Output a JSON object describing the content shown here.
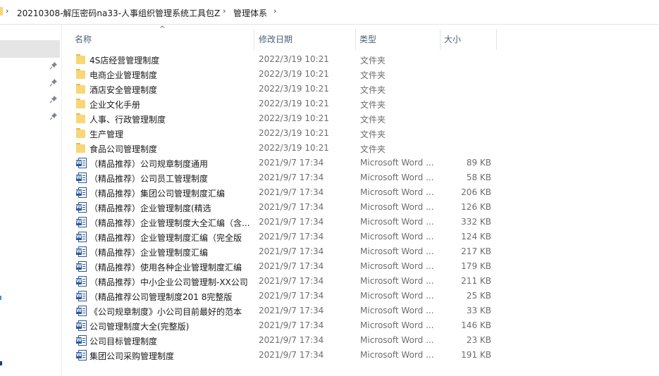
{
  "breadcrumb": {
    "items": [
      "20210308-解压密码na33-人事组织管理系统工具包Z",
      "管理体系"
    ],
    "separator": "›"
  },
  "columns": {
    "name": "名称",
    "modified": "修改日期",
    "type": "类型",
    "size": "大小"
  },
  "colors": {
    "folder": "#f8d775",
    "word": "#2b579a",
    "header_text": "#4c607a",
    "nav_selected": "#e5e5e5"
  },
  "files": [
    {
      "name": "4S店经营管理制度",
      "date": "2022/3/19 10:21",
      "type": "文件夹",
      "size": "",
      "icon": "folder-icon"
    },
    {
      "name": "电商企业管理制度",
      "date": "2022/3/19 10:21",
      "type": "文件夹",
      "size": "",
      "icon": "folder-icon"
    },
    {
      "name": "酒店安全管理制度",
      "date": "2022/3/19 10:21",
      "type": "文件夹",
      "size": "",
      "icon": "folder-icon"
    },
    {
      "name": "企业文化手册",
      "date": "2022/3/19 10:21",
      "type": "文件夹",
      "size": "",
      "icon": "folder-icon"
    },
    {
      "name": "人事、行政管理制度",
      "date": "2022/3/19 10:21",
      "type": "文件夹",
      "size": "",
      "icon": "folder-icon"
    },
    {
      "name": "生产管理",
      "date": "2022/3/19 10:21",
      "type": "文件夹",
      "size": "",
      "icon": "folder-icon"
    },
    {
      "name": "食品公司管理制度",
      "date": "2022/3/19 10:21",
      "type": "文件夹",
      "size": "",
      "icon": "folder-icon"
    },
    {
      "name": "（精品推荐）公司规章制度通用",
      "date": "2021/9/7 17:34",
      "type": "Microsoft Word ...",
      "size": "89 KB",
      "icon": "word-doc-icon"
    },
    {
      "name": "（精品推荐）公司员工管理制度",
      "date": "2021/9/7 17:34",
      "type": "Microsoft Word ...",
      "size": "58 KB",
      "icon": "word-doc-icon"
    },
    {
      "name": "（精品推荐）集团公司管理制度汇编",
      "date": "2021/9/7 17:34",
      "type": "Microsoft Word ...",
      "size": "206 KB",
      "icon": "word-doc-icon"
    },
    {
      "name": "（精品推荐）企业管理制度(精选",
      "date": "2021/9/7 17:34",
      "type": "Microsoft Word ...",
      "size": "126 KB",
      "icon": "word-doc-icon"
    },
    {
      "name": "（精品推荐）企业管理制度大全汇编（含...",
      "date": "2021/9/7 17:34",
      "type": "Microsoft Word ...",
      "size": "332 KB",
      "icon": "word-doc-icon"
    },
    {
      "name": "（精品推荐）企业管理制度汇编（完全版",
      "date": "2021/9/7 17:34",
      "type": "Microsoft Word ...",
      "size": "124 KB",
      "icon": "word-doc-icon"
    },
    {
      "name": "（精品推荐）企业管理制度汇编",
      "date": "2021/9/7 17:34",
      "type": "Microsoft Word ...",
      "size": "217 KB",
      "icon": "word-doc-icon"
    },
    {
      "name": "（精品推荐）使用各种企业管理制度汇编",
      "date": "2021/9/7 17:34",
      "type": "Microsoft Word ...",
      "size": "179 KB",
      "icon": "word-doc-icon"
    },
    {
      "name": "（精品推荐）中小企业公司管理制-XX公司",
      "date": "2021/9/7 17:34",
      "type": "Microsoft Word ...",
      "size": "211 KB",
      "icon": "word-doc-icon"
    },
    {
      "name": "（精品推荐公司管理制度201 8完整版",
      "date": "2021/9/7 17:34",
      "type": "Microsoft Word ...",
      "size": "25 KB",
      "icon": "word-doc-icon"
    },
    {
      "name": "《公司规章制度》小公司目前最好的范本",
      "date": "2021/9/7 17:34",
      "type": "Microsoft Word ...",
      "size": "33 KB",
      "icon": "word-doc-icon"
    },
    {
      "name": "公司管理制度大全(完整版)",
      "date": "2021/9/7 17:34",
      "type": "Microsoft Word ...",
      "size": "146 KB",
      "icon": "word-doc-icon"
    },
    {
      "name": "公司目标管理制度",
      "date": "2021/9/7 17:34",
      "type": "Microsoft Word ...",
      "size": "23 KB",
      "icon": "word-doc-icon"
    },
    {
      "name": "集团公司采购管理制度",
      "date": "2021/9/7 17:34",
      "type": "Microsoft Word ...",
      "size": "191 KB",
      "icon": "word-doc-icon"
    }
  ]
}
